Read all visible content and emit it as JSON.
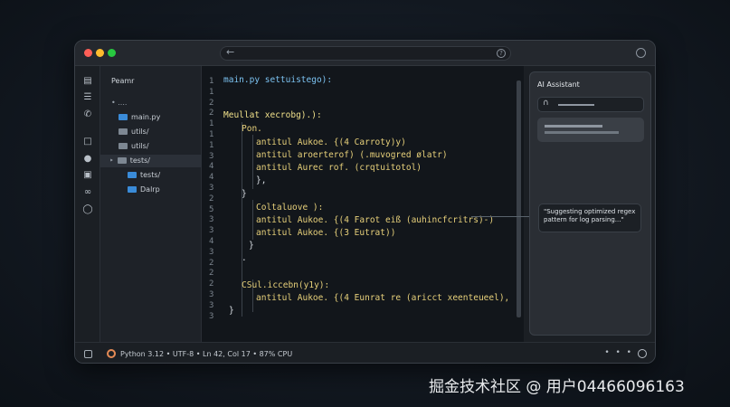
{
  "window": {
    "colors": {
      "close": "#ff5f57",
      "minimize": "#febc2e",
      "maximize": "#28c840"
    }
  },
  "addressbar": {
    "back_icon": "arrow-left-icon",
    "help_icon": "help-icon"
  },
  "activity_bar": {
    "icons": [
      "files-icon",
      "list-icon",
      "phone-icon",
      "folder-icon",
      "user-icon",
      "bookmark-icon",
      "link-icon",
      "circle-icon"
    ]
  },
  "explorer": {
    "header": "Peamr",
    "root": "• ....",
    "items": [
      "main.py",
      "utils/",
      "utils/",
      "tests/",
      "tests/",
      "Dalrp"
    ]
  },
  "editor": {
    "line_numbers": [
      "1",
      "1",
      "2",
      "2",
      "1",
      "1",
      "1",
      "3",
      "4",
      "4",
      "3",
      "2",
      "5",
      "3",
      "3",
      "4",
      "3",
      "2",
      "2",
      "2",
      "3",
      "3",
      "3"
    ],
    "lines": [
      "main.py settuistego):",
      "Meullat xecrobg).):",
      "Pon.",
      "antitul Aukoe. {(4 Carroty)y)",
      "antitul aroerterof) (.muvogred ølatr)",
      "antitul Aurec rof. (crqtuitotol)",
      "},",
      "}",
      "Coltaluove ):",
      "antitul Aukoe. {(4 Farot eiß (auhincfcritrs)-)",
      "antitul Aukoe. {(3 Eutrat))",
      "}",
      ".",
      "CSul.iccebn(y1y):",
      "antitul Aukoe. {(4 Eunrat re (aricct xeenteueel),",
      "}"
    ]
  },
  "ai_panel": {
    "title": "AI Assistant",
    "input_icon": "prompt-icon",
    "suggestion": "\"Suggesting optimized regex pattern for log parsing...\""
  },
  "statusbar": {
    "text": "Python 3.12 • UTF-8 • Ln 42, Col 17 • 87% CPU",
    "more": "• • •"
  },
  "watermark": "掘金技术社区 @ 用户04466096163"
}
